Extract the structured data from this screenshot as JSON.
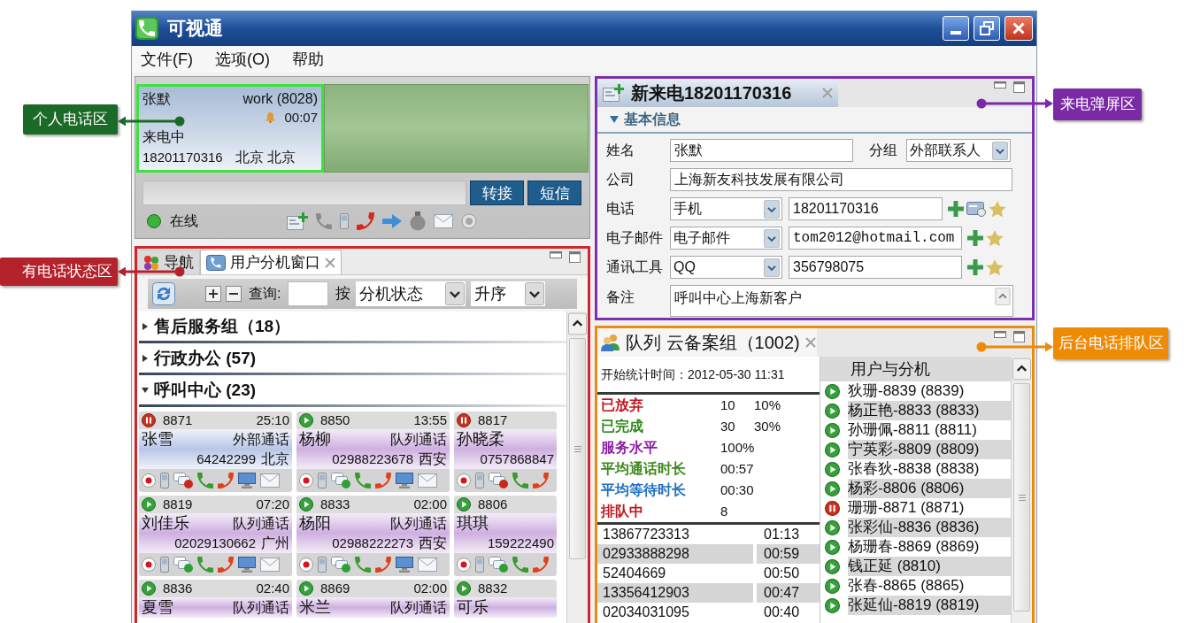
{
  "window": {
    "title": "可视通"
  },
  "menu": [
    {
      "label": "文件(F)"
    },
    {
      "label": "选项(O)"
    },
    {
      "label": "帮助"
    }
  ],
  "personal_phone": {
    "call": {
      "name": "张默",
      "line": "work (8028)",
      "timer": "00:07",
      "status": "来电中",
      "number": "18201170316",
      "location": "北京 北京"
    },
    "buttons": [
      "转接",
      "短信"
    ],
    "presence": {
      "label": "在线",
      "online": true
    }
  },
  "extensions": {
    "tabs": [
      {
        "label": "导航",
        "selected": false,
        "closable": false
      },
      {
        "label": "用户分机窗口",
        "selected": true,
        "closable": true
      }
    ],
    "toolbar": {
      "query_label": "查询:",
      "sort_label": "按",
      "sort_field": "分机状态",
      "sort_order": "升序"
    },
    "groups": [
      {
        "label": "售后服务组（18）",
        "expanded": false
      },
      {
        "label": "行政办公 (57)",
        "expanded": false
      },
      {
        "label": "呼叫中心 (23)",
        "expanded": true,
        "extensions": [
          {
            "kind": "external",
            "on_hold": true,
            "ext": "8871",
            "time": "25:10",
            "name": "张雪",
            "call_type": "外部通话",
            "number": "64242299",
            "location": "北京"
          },
          {
            "kind": "queue",
            "on_hold": false,
            "ext": "8850",
            "time": "13:55",
            "name": "杨柳",
            "call_type": "队列通话",
            "number": "02988223678",
            "location": "西安"
          },
          {
            "kind": "queue",
            "on_hold": true,
            "ext": "8817",
            "name": "孙晓柔",
            "number": "0757868847"
          },
          {
            "kind": "queue",
            "on_hold": false,
            "ext": "8819",
            "time": "07:20",
            "name": "刘佳乐",
            "call_type": "队列通话",
            "number": "02029130662",
            "location": "广州"
          },
          {
            "kind": "queue",
            "on_hold": false,
            "ext": "8833",
            "time": "02:00",
            "name": "杨阳",
            "call_type": "队列通话",
            "number": "02988222273",
            "location": "西安"
          },
          {
            "kind": "queue",
            "on_hold": false,
            "ext": "8806",
            "name": "琪琪",
            "number": "159222490"
          },
          {
            "kind": "queue",
            "on_hold": false,
            "ext": "8836",
            "time": "02:40",
            "name": "夏雪",
            "call_type": "队列通话"
          },
          {
            "kind": "queue",
            "on_hold": false,
            "ext": "8869",
            "time": "02:00",
            "name": "米兰",
            "call_type": "队列通话"
          },
          {
            "kind": "queue",
            "on_hold": false,
            "ext": "8832",
            "name": "可乐"
          }
        ]
      }
    ]
  },
  "incoming": {
    "tab": {
      "label": "新来电18201170316",
      "closable": true
    },
    "section": {
      "label": "基本信息",
      "expanded": true
    },
    "name": {
      "label": "姓名",
      "value": "张默"
    },
    "group": {
      "label": "分组",
      "value": "外部联系人"
    },
    "company": {
      "label": "公司",
      "value": "上海新友科技发展有限公司"
    },
    "contacts": [
      {
        "kind": "phone",
        "label": "电话",
        "type": "手机",
        "value": "18201170316"
      },
      {
        "kind": "email",
        "label": "电子邮件",
        "type": "电子邮件",
        "value": "tom2012@hotmail.com"
      },
      {
        "kind": "im",
        "label": "通讯工具",
        "type": "QQ",
        "value": "356798075"
      }
    ],
    "remark": {
      "label": "备注",
      "value": "呼叫中心上海新客户"
    }
  },
  "queue": {
    "tab": {
      "label": "队列 云备案组（1002)",
      "closable": true
    },
    "stats_start": {
      "label": "开始统计时间：",
      "value": "2012-05-30 11:31"
    },
    "stats": [
      {
        "label": "已放弃",
        "color": "#c0181f",
        "value": "10",
        "percent": "10%"
      },
      {
        "label": "已完成",
        "color": "#2e8a1c",
        "value": "30",
        "percent": "30%"
      },
      {
        "label": "服务水平",
        "color": "#8b1fa3",
        "value": "100%"
      },
      {
        "label": "平均通话时长",
        "color": "#3b8a18",
        "value": "00:57"
      },
      {
        "label": "平均等待时长",
        "color": "#1f6fc2",
        "value": "00:30"
      },
      {
        "label": "排队中",
        "color": "#c0181f",
        "value": "8"
      }
    ],
    "waiting": [
      {
        "number": "13867723313",
        "time": "01:13"
      },
      {
        "number": "02933888298",
        "time": "00:59"
      },
      {
        "number": "52404669",
        "time": "00:50"
      },
      {
        "number": "13356412903",
        "time": "00:47"
      },
      {
        "number": "02034031095",
        "time": "00:40"
      }
    ],
    "members_header": "用户与分机",
    "members": [
      {
        "name": "狄珊-8839 (8839)",
        "on_hold": false
      },
      {
        "name": "杨正艳-8833 (8833)",
        "on_hold": false
      },
      {
        "name": "孙珊佩-8811 (8811)",
        "on_hold": false
      },
      {
        "name": "宁英彩-8809 (8809)",
        "on_hold": false
      },
      {
        "name": "张春狄-8838 (8838)",
        "on_hold": false
      },
      {
        "name": "杨彩-8806 (8806)",
        "on_hold": false
      },
      {
        "name": "珊珊-8871 (8871)",
        "on_hold": true
      },
      {
        "name": "张彩仙-8836 (8836)",
        "on_hold": false
      },
      {
        "name": "杨珊春-8869 (8869)",
        "on_hold": false
      },
      {
        "name": "钱正延 (8810)",
        "on_hold": false
      },
      {
        "name": "张春-8865 (8865)",
        "on_hold": false
      },
      {
        "name": "张延仙-8819 (8819)",
        "on_hold": false
      }
    ]
  },
  "callouts": [
    {
      "text": "个人电话区",
      "color": "#1c6a28"
    },
    {
      "text": "来电弹屏区",
      "color": "#7b2aa6"
    },
    {
      "text": "有电话状态区",
      "color": "#b4222b"
    },
    {
      "text": "后台电话排队区",
      "color": "#ee8a06"
    }
  ]
}
